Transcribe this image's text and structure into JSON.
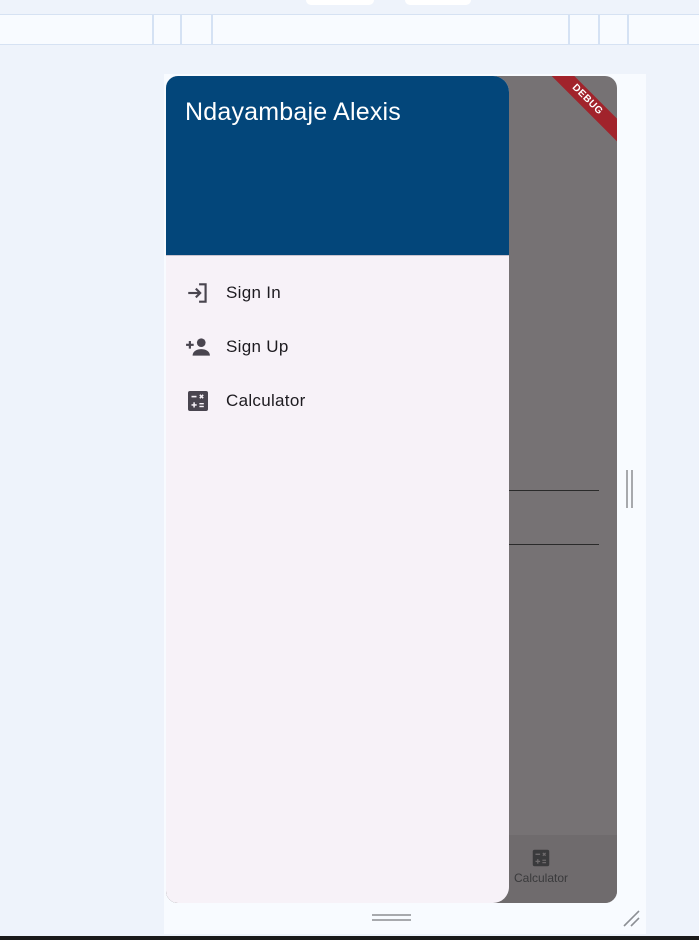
{
  "drawer": {
    "header_title": "Ndayambaje Alexis",
    "items": [
      {
        "label": "Sign In",
        "icon": "login-icon"
      },
      {
        "label": "Sign Up",
        "icon": "person-add-icon"
      },
      {
        "label": "Calculator",
        "icon": "calculate-icon"
      }
    ]
  },
  "bottom_nav": {
    "items": [
      {
        "label": "Calculator",
        "icon": "calculate-icon"
      }
    ]
  },
  "debug_banner": "DEBUG",
  "colors": {
    "header_bg": "#03467a",
    "drawer_bg": "#f7f2f8",
    "scrim": "#767274",
    "debug_banner": "#a1232b"
  }
}
